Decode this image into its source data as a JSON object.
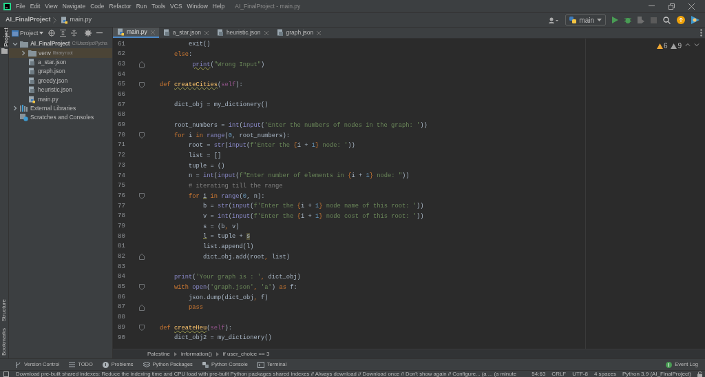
{
  "menu": [
    "File",
    "Edit",
    "View",
    "Navigate",
    "Code",
    "Refactor",
    "Run",
    "Tools",
    "VCS",
    "Window",
    "Help"
  ],
  "window": {
    "title": "AI_FinalProject - main.py"
  },
  "navbar": {
    "breadcrumbs": [
      {
        "kind": "project",
        "text": "AI_FinalProject"
      },
      {
        "kind": "python",
        "text": "main.py"
      }
    ],
    "run_config": "main"
  },
  "project_panel": {
    "title": "Project",
    "tree": [
      {
        "kind": "folder",
        "label": "AI_FinalProject",
        "hint": "C:\\Users\\pc\\Pycha",
        "expanded": true,
        "selected": false,
        "children": [
          {
            "kind": "folder",
            "label": "venv",
            "hint": "library root",
            "expanded": false,
            "selected": true
          },
          {
            "kind": "json",
            "label": "a_star.json",
            "selected": false
          },
          {
            "kind": "json",
            "label": "graph.json",
            "selected": false
          },
          {
            "kind": "json",
            "label": "greedy.json",
            "selected": false
          },
          {
            "kind": "json",
            "label": "heuristic.json",
            "selected": false
          },
          {
            "kind": "python",
            "label": "main.py",
            "selected": false
          }
        ]
      },
      {
        "kind": "libraries",
        "label": "External Libraries",
        "expanded": false,
        "selected": false
      },
      {
        "kind": "scratches",
        "label": "Scratches and Consoles",
        "selected": false
      }
    ]
  },
  "side_labels": [
    {
      "text": "Project",
      "selected": true
    },
    {
      "text": "Structure",
      "selected": false
    },
    {
      "text": "Bookmarks",
      "selected": false
    }
  ],
  "tabs": [
    {
      "kind": "python",
      "label": "main.py",
      "selected": true
    },
    {
      "kind": "json",
      "label": "a_star.json",
      "selected": false
    },
    {
      "kind": "json",
      "label": "heuristic.json",
      "selected": false
    },
    {
      "kind": "json",
      "label": "graph.json",
      "selected": false
    }
  ],
  "inspections": {
    "warnings": "6",
    "weak_warnings": "9"
  },
  "code": [
    {
      "n": "61",
      "kind": "plain",
      "tokens": [
        {
          "kind": "plain",
          "text": "            exit()"
        }
      ]
    },
    {
      "n": "62",
      "kind": "plain",
      "tokens": [
        {
          "kind": "keyword",
          "text": "        else"
        },
        {
          "kind": "plain",
          "text": ":"
        }
      ]
    },
    {
      "n": "63",
      "kind": "fold-end",
      "tokens": [
        {
          "kind": "builtin-warn",
          "text": "             print"
        },
        {
          "kind": "plain",
          "text": "("
        },
        {
          "kind": "string",
          "text": "\"Wrong Input\""
        },
        {
          "kind": "plain",
          "text": ")"
        }
      ]
    },
    {
      "n": "64",
      "kind": "plain"
    },
    {
      "n": "65",
      "kind": "fold-start",
      "tokens": [
        {
          "kind": "keyword",
          "text": "    def "
        },
        {
          "kind": "funcdef",
          "text": "createCities"
        },
        {
          "kind": "plain",
          "text": "("
        },
        {
          "kind": "self",
          "text": "self"
        },
        {
          "kind": "plain",
          "text": "):"
        }
      ]
    },
    {
      "n": "66",
      "kind": "plain"
    },
    {
      "n": "67",
      "kind": "plain",
      "tokens": [
        {
          "kind": "plain",
          "text": "        dict_obj = my_dictionery()"
        }
      ]
    },
    {
      "n": "68",
      "kind": "plain"
    },
    {
      "n": "69",
      "kind": "plain",
      "tokens": [
        {
          "kind": "plain",
          "text": "        root_numbers = "
        },
        {
          "kind": "builtin",
          "text": "int"
        },
        {
          "kind": "plain",
          "text": "("
        },
        {
          "kind": "builtin",
          "text": "input"
        },
        {
          "kind": "plain",
          "text": "("
        },
        {
          "kind": "string",
          "text": "'Enter the numbers of nodes in the graph: '"
        },
        {
          "kind": "plain",
          "text": "))"
        }
      ]
    },
    {
      "n": "70",
      "kind": "fold-start",
      "tokens": [
        {
          "kind": "keyword",
          "text": "        for "
        },
        {
          "kind": "plain",
          "text": "i "
        },
        {
          "kind": "keyword",
          "text": "in "
        },
        {
          "kind": "builtin",
          "text": "range"
        },
        {
          "kind": "plain",
          "text": "("
        },
        {
          "kind": "number",
          "text": "0"
        },
        {
          "kind": "plain",
          "text": ", root_numbers):"
        }
      ]
    },
    {
      "n": "71",
      "kind": "plain",
      "tokens": [
        {
          "kind": "plain",
          "text": "            root = "
        },
        {
          "kind": "builtin",
          "text": "str"
        },
        {
          "kind": "plain",
          "text": "("
        },
        {
          "kind": "builtin",
          "text": "input"
        },
        {
          "kind": "plain",
          "text": "("
        },
        {
          "kind": "string",
          "text": "f'Enter the "
        },
        {
          "kind": "keyword",
          "text": "{"
        },
        {
          "kind": "plain",
          "text": "i + "
        },
        {
          "kind": "number",
          "text": "1"
        },
        {
          "kind": "keyword",
          "text": "}"
        },
        {
          "kind": "string",
          "text": " node: '"
        },
        {
          "kind": "plain",
          "text": "))"
        }
      ]
    },
    {
      "n": "72",
      "kind": "plain",
      "tokens": [
        {
          "kind": "plain",
          "text": "            list = []"
        }
      ]
    },
    {
      "n": "73",
      "kind": "plain",
      "tokens": [
        {
          "kind": "plain",
          "text": "            tuple = ()"
        }
      ]
    },
    {
      "n": "74",
      "kind": "plain",
      "tokens": [
        {
          "kind": "plain",
          "text": "            n = "
        },
        {
          "kind": "builtin",
          "text": "int"
        },
        {
          "kind": "plain",
          "text": "("
        },
        {
          "kind": "builtin",
          "text": "input"
        },
        {
          "kind": "plain",
          "text": "("
        },
        {
          "kind": "string",
          "text": "f\"Enter number of elements in "
        },
        {
          "kind": "keyword",
          "text": "{"
        },
        {
          "kind": "plain",
          "text": "i + "
        },
        {
          "kind": "number",
          "text": "1"
        },
        {
          "kind": "keyword",
          "text": "}"
        },
        {
          "kind": "string",
          "text": " node: \""
        },
        {
          "kind": "plain",
          "text": "))"
        }
      ]
    },
    {
      "n": "75",
      "kind": "plain",
      "tokens": [
        {
          "kind": "comment",
          "text": "            # iterating till the range"
        }
      ]
    },
    {
      "n": "76",
      "kind": "fold-start",
      "tokens": [
        {
          "kind": "keyword",
          "text": "            for "
        },
        {
          "kind": "plain-warn",
          "text": "i"
        },
        {
          "kind": "keyword",
          "text": " in "
        },
        {
          "kind": "builtin",
          "text": "range"
        },
        {
          "kind": "plain",
          "text": "("
        },
        {
          "kind": "number",
          "text": "0"
        },
        {
          "kind": "plain",
          "text": ", n):"
        }
      ]
    },
    {
      "n": "77",
      "kind": "plain",
      "tokens": [
        {
          "kind": "plain",
          "text": "                b = "
        },
        {
          "kind": "builtin",
          "text": "str"
        },
        {
          "kind": "plain",
          "text": "("
        },
        {
          "kind": "builtin",
          "text": "input"
        },
        {
          "kind": "plain",
          "text": "("
        },
        {
          "kind": "string",
          "text": "f'Enter the "
        },
        {
          "kind": "keyword",
          "text": "{"
        },
        {
          "kind": "plain",
          "text": "i + "
        },
        {
          "kind": "number",
          "text": "1"
        },
        {
          "kind": "keyword",
          "text": "}"
        },
        {
          "kind": "string",
          "text": " node name of this root: '"
        },
        {
          "kind": "plain",
          "text": "))"
        }
      ]
    },
    {
      "n": "78",
      "kind": "plain",
      "tokens": [
        {
          "kind": "plain",
          "text": "                v = "
        },
        {
          "kind": "builtin",
          "text": "int"
        },
        {
          "kind": "plain",
          "text": "("
        },
        {
          "kind": "builtin",
          "text": "input"
        },
        {
          "kind": "plain",
          "text": "("
        },
        {
          "kind": "string",
          "text": "f'Enter the "
        },
        {
          "kind": "keyword",
          "text": "{"
        },
        {
          "kind": "plain",
          "text": "i + "
        },
        {
          "kind": "number",
          "text": "1"
        },
        {
          "kind": "keyword",
          "text": "}"
        },
        {
          "kind": "string",
          "text": " node cost of this root: '"
        },
        {
          "kind": "plain",
          "text": "))"
        }
      ]
    },
    {
      "n": "79",
      "kind": "plain",
      "tokens": [
        {
          "kind": "plain",
          "text": "                s = (b"
        },
        {
          "kind": "keyword",
          "text": ", "
        },
        {
          "kind": "plain",
          "text": "v)"
        }
      ]
    },
    {
      "n": "80",
      "kind": "plain",
      "tokens": [
        {
          "kind": "plain-warn",
          "text": "                l"
        },
        {
          "kind": "plain",
          "text": " = tuple + "
        },
        {
          "kind": "plain-mark",
          "text": "s"
        }
      ]
    },
    {
      "n": "81",
      "kind": "plain",
      "tokens": [
        {
          "kind": "plain",
          "text": "                list.append(l)"
        }
      ]
    },
    {
      "n": "82",
      "kind": "fold-end",
      "tokens": [
        {
          "kind": "plain",
          "text": "                dict_obj.add(root"
        },
        {
          "kind": "keyword",
          "text": ", "
        },
        {
          "kind": "plain",
          "text": "list)"
        }
      ]
    },
    {
      "n": "83",
      "kind": "plain"
    },
    {
      "n": "84",
      "kind": "plain",
      "tokens": [
        {
          "kind": "builtin",
          "text": "        print"
        },
        {
          "kind": "plain",
          "text": "("
        },
        {
          "kind": "string",
          "text": "'Your graph is : '"
        },
        {
          "kind": "keyword",
          "text": ", "
        },
        {
          "kind": "plain",
          "text": "dict_obj)"
        }
      ]
    },
    {
      "n": "85",
      "kind": "fold-start",
      "tokens": [
        {
          "kind": "keyword",
          "text": "        with "
        },
        {
          "kind": "builtin",
          "text": "open"
        },
        {
          "kind": "plain",
          "text": "("
        },
        {
          "kind": "string",
          "text": "'graph.json'"
        },
        {
          "kind": "keyword",
          "text": ", "
        },
        {
          "kind": "string",
          "text": "'a'"
        },
        {
          "kind": "plain",
          "text": ") "
        },
        {
          "kind": "keyword",
          "text": "as "
        },
        {
          "kind": "plain",
          "text": "f:"
        }
      ]
    },
    {
      "n": "86",
      "kind": "plain",
      "tokens": [
        {
          "kind": "plain",
          "text": "            json.dump(dict_obj"
        },
        {
          "kind": "keyword",
          "text": ", "
        },
        {
          "kind": "plain",
          "text": "f)"
        }
      ]
    },
    {
      "n": "87",
      "kind": "fold-end",
      "tokens": [
        {
          "kind": "keyword",
          "text": "            pass"
        }
      ]
    },
    {
      "n": "88",
      "kind": "plain"
    },
    {
      "n": "89",
      "kind": "fold-start",
      "tokens": [
        {
          "kind": "keyword",
          "text": "    def "
        },
        {
          "kind": "funcdef",
          "text": "createHeu"
        },
        {
          "kind": "plain",
          "text": "("
        },
        {
          "kind": "self",
          "text": "self"
        },
        {
          "kind": "plain",
          "text": "):"
        }
      ]
    },
    {
      "n": "90",
      "kind": "plain",
      "tokens": [
        {
          "kind": "plain",
          "text": "        dict_obj2 = my_dictionery()"
        }
      ]
    }
  ],
  "editor_breadcrumbs": [
    "Palestine",
    "information()",
    "if user_choice == 3"
  ],
  "tool_windows": [
    {
      "kind": "vcs",
      "label": "Version Control"
    },
    {
      "kind": "todo",
      "label": "TODO"
    },
    {
      "kind": "problems",
      "label": "Problems"
    },
    {
      "kind": "packages",
      "label": "Python Packages"
    },
    {
      "kind": "console",
      "label": "Python Console"
    },
    {
      "kind": "terminal",
      "label": "Terminal"
    }
  ],
  "event_log": "Event Log",
  "status_bar": {
    "message": "Download pre-built shared indexes: Reduce the indexing time and CPU load with pre-built Python packages shared indexes // Always download // Download once // Don't show again // Configure... (a ... (a minute",
    "items": [
      "54:63",
      "CRLF",
      "UTF-8",
      "4 spaces",
      "Python 3.9 (AI_FinalProject)"
    ]
  }
}
